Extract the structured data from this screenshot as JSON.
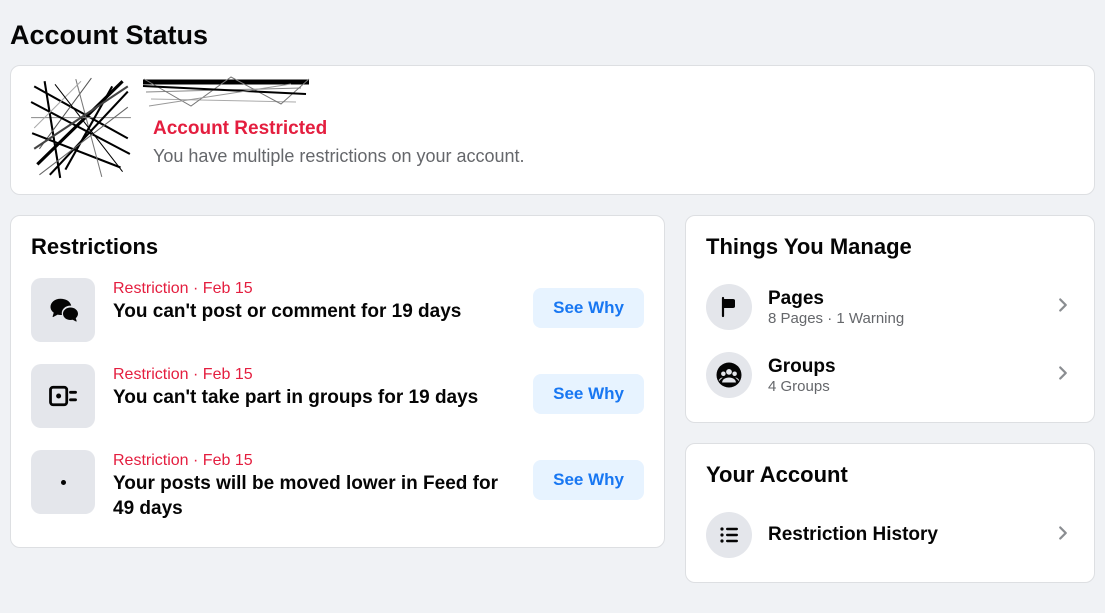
{
  "pageTitle": "Account Status",
  "status": {
    "heading": "Account Restricted",
    "subtext": "You have multiple restrictions on your account."
  },
  "restrictions": {
    "heading": "Restrictions",
    "seeWhyLabel": "See Why",
    "items": [
      {
        "meta": "Restriction · Feb 15",
        "title": "You can't post or comment for 19 days"
      },
      {
        "meta": "Restriction · Feb 15",
        "title": "You can't take part in groups for 19 days"
      },
      {
        "meta": "Restriction · Feb 15",
        "title": "Your posts will be moved lower in Feed for 49 days"
      }
    ]
  },
  "manage": {
    "heading": "Things You Manage",
    "items": [
      {
        "title": "Pages",
        "sub": "8 Pages · 1 Warning"
      },
      {
        "title": "Groups",
        "sub": "4 Groups"
      }
    ]
  },
  "account": {
    "heading": "Your Account",
    "restrictionHistory": "Restriction History"
  }
}
